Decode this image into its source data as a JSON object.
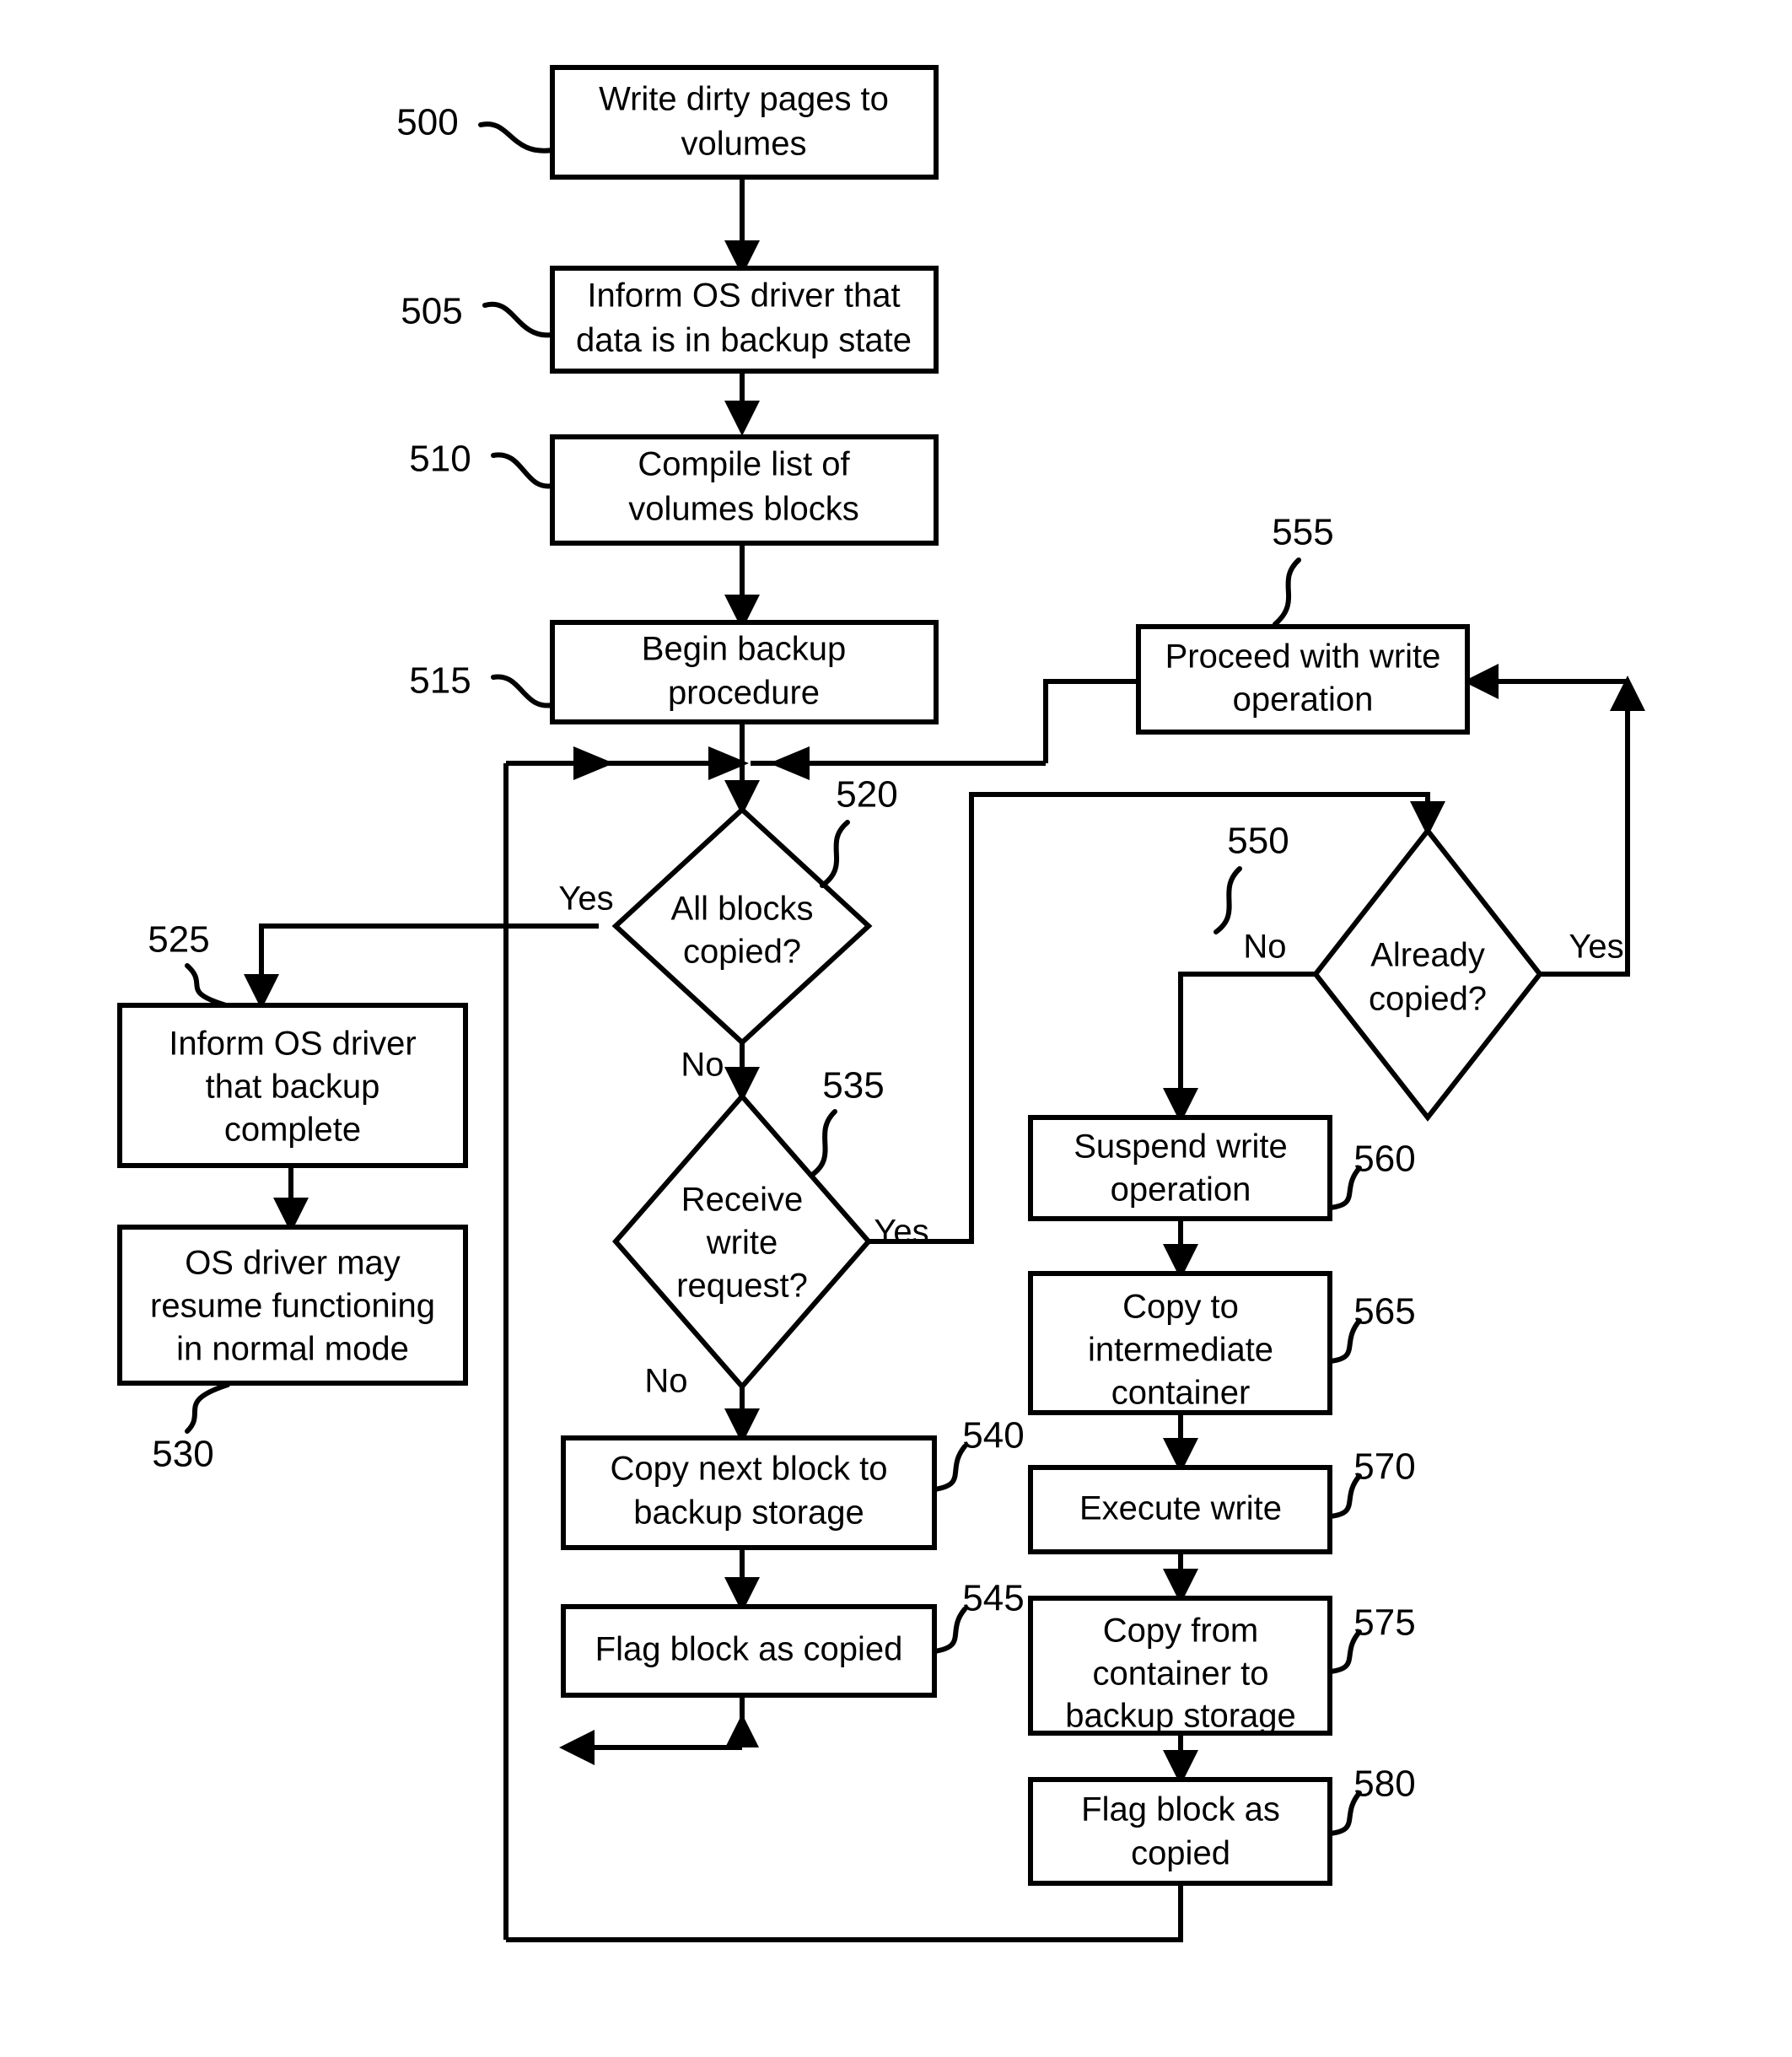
{
  "diagram": {
    "title": "Backup procedure flowchart",
    "colors": {
      "stroke": "#000000",
      "fill": "#ffffff",
      "text": "#000000"
    },
    "nodes": [
      {
        "ref": "500",
        "type": "process",
        "lines": [
          "Write dirty pages to",
          "volumes"
        ]
      },
      {
        "ref": "505",
        "type": "process",
        "lines": [
          "Inform OS driver that",
          "data is in backup state"
        ]
      },
      {
        "ref": "510",
        "type": "process",
        "lines": [
          "Compile list of",
          "volumes blocks"
        ]
      },
      {
        "ref": "515",
        "type": "process",
        "lines": [
          "Begin backup",
          "procedure"
        ]
      },
      {
        "ref": "520",
        "type": "decision",
        "lines": [
          "All blocks",
          "copied?"
        ]
      },
      {
        "ref": "525",
        "type": "process",
        "lines": [
          "Inform OS driver",
          "that backup",
          "complete"
        ]
      },
      {
        "ref": "530",
        "type": "process",
        "lines": [
          "OS driver may",
          "resume functioning",
          "in normal mode"
        ]
      },
      {
        "ref": "535",
        "type": "decision",
        "lines": [
          "Receive",
          "write",
          "request?"
        ]
      },
      {
        "ref": "540",
        "type": "process",
        "lines": [
          "Copy next block to",
          "backup storage"
        ]
      },
      {
        "ref": "545",
        "type": "process",
        "lines": [
          "Flag block as copied"
        ]
      },
      {
        "ref": "550",
        "type": "decision",
        "lines": [
          "Already",
          "copied?"
        ]
      },
      {
        "ref": "555",
        "type": "process",
        "lines": [
          "Proceed with write",
          "operation"
        ]
      },
      {
        "ref": "560",
        "type": "process",
        "lines": [
          "Suspend write",
          "operation"
        ]
      },
      {
        "ref": "565",
        "type": "process",
        "lines": [
          "Copy to",
          "intermediate",
          "container"
        ]
      },
      {
        "ref": "570",
        "type": "process",
        "lines": [
          "Execute write"
        ]
      },
      {
        "ref": "575",
        "type": "process",
        "lines": [
          "Copy from",
          "container to",
          "backup storage"
        ]
      },
      {
        "ref": "580",
        "type": "process",
        "lines": [
          "Flag block as",
          "copied"
        ]
      }
    ],
    "branch_labels": {
      "d520_yes": "Yes",
      "d520_no": "No",
      "d535_yes": "Yes",
      "d535_no": "No",
      "d550_no": "No",
      "d550_yes": "Yes"
    },
    "reference_numerals": {
      "n500": "500",
      "n505": "505",
      "n510": "510",
      "n515": "515",
      "n520": "520",
      "n525": "525",
      "n530": "530",
      "n535": "535",
      "n540": "540",
      "n545": "545",
      "n550": "550",
      "n555": "555",
      "n560": "560",
      "n565": "565",
      "n570": "570",
      "n575": "575",
      "n580": "580"
    },
    "node_text": {
      "n500_l1": "Write dirty pages to",
      "n500_l2": "volumes",
      "n505_l1": "Inform OS driver that",
      "n505_l2": "data is in backup state",
      "n510_l1": "Compile list of",
      "n510_l2": "volumes blocks",
      "n515_l1": "Begin backup",
      "n515_l2": "procedure",
      "n520_l1": "All blocks",
      "n520_l2": "copied?",
      "n525_l1": "Inform OS driver",
      "n525_l2": "that backup",
      "n525_l3": "complete",
      "n530_l1": "OS driver may",
      "n530_l2": "resume functioning",
      "n530_l3": "in normal mode",
      "n535_l1": "Receive",
      "n535_l2": "write",
      "n535_l3": "request?",
      "n540_l1": "Copy next block to",
      "n540_l2": "backup storage",
      "n545_l1": "Flag block as copied",
      "n550_l1": "Already",
      "n550_l2": "copied?",
      "n555_l1": "Proceed with write",
      "n555_l2": "operation",
      "n560_l1": "Suspend write",
      "n560_l2": "operation",
      "n565_l1": "Copy to",
      "n565_l2": "intermediate",
      "n565_l3": "container",
      "n570_l1": "Execute write",
      "n575_l1": "Copy from",
      "n575_l2": "container to",
      "n575_l3": "backup storage",
      "n580_l1": "Flag block as",
      "n580_l2": "copied"
    }
  }
}
